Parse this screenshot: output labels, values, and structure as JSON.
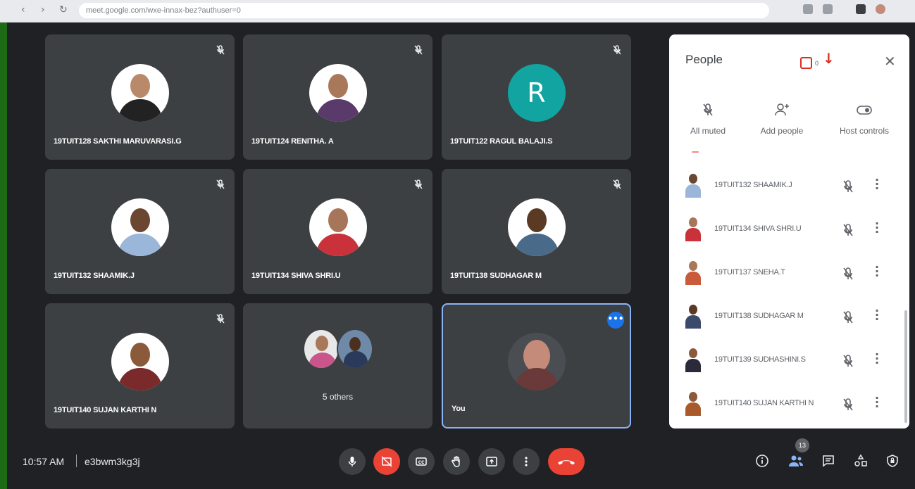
{
  "browser": {
    "url": "meet.google.com/wxe-innax-bez?authuser=0"
  },
  "tiles": [
    {
      "name": "19TUIT128 SAKTHI MARUVARASI.G",
      "skin": "#b98a6a",
      "shirt": "#222"
    },
    {
      "name": "19TUIT124 RENITHA. A",
      "skin": "#a9775a",
      "shirt": "#5a3a6a"
    },
    {
      "name": "19TUIT122 RAGUL BALAJI.S",
      "initial": "R"
    },
    {
      "name": "19TUIT132 SHAAMIK.J",
      "skin": "#6b4630",
      "shirt": "#9ab6d8"
    },
    {
      "name": "19TUIT134 SHIVA SHRI.U",
      "skin": "#a7765a",
      "shirt": "#c9323a"
    },
    {
      "name": "19TUIT138 SUDHAGAR M",
      "skin": "#5b3a24",
      "shirt": "#4a6a8a"
    },
    {
      "name": "19TUIT140 SUJAN KARTHI N",
      "skin": "#8a5a3a",
      "shirt": "#7a2a2a"
    },
    {
      "others_label": "5 others"
    },
    {
      "name": "You",
      "skin": "#c48a7a",
      "shirt": "#6a3a3a"
    }
  ],
  "panel": {
    "title": "People",
    "badge_count": "0",
    "controls": [
      {
        "label": "All muted",
        "icon": "mic-off-icon"
      },
      {
        "label": "Add people",
        "icon": "add-person-icon"
      },
      {
        "label": "Host controls",
        "icon": "toggle-icon"
      }
    ],
    "participants": [
      {
        "name": "19TUIT132 SHAAMIK.J",
        "skin": "#6b4630",
        "shirt": "#9ab6d8"
      },
      {
        "name": "19TUIT134 SHIVA SHRI.U",
        "skin": "#a7765a",
        "shirt": "#c9323a"
      },
      {
        "name": "19TUIT137 SNEHA.T",
        "skin": "#a9775a",
        "shirt": "#c95a3a"
      },
      {
        "name": "19TUIT138 SUDHAGAR M",
        "skin": "#5b3a24",
        "shirt": "#3a4a6a"
      },
      {
        "name": "19TUIT139 SUDHASHINI.S",
        "skin": "#8a5a3a",
        "shirt": "#2a2a3a"
      },
      {
        "name": "19TUIT140 SUJAN KARTHI N",
        "skin": "#8a5a3a",
        "shirt": "#aa5a2a"
      }
    ]
  },
  "bottom": {
    "time": "10:57 AM",
    "code": "e3bwm3kg3j",
    "participants_count": "13"
  },
  "colors": {
    "accent": "#1a73e8",
    "danger": "#ea4335",
    "tile_bg": "#3c4043",
    "stage_bg": "#202124",
    "teal_avatar": "#12a4a0"
  }
}
